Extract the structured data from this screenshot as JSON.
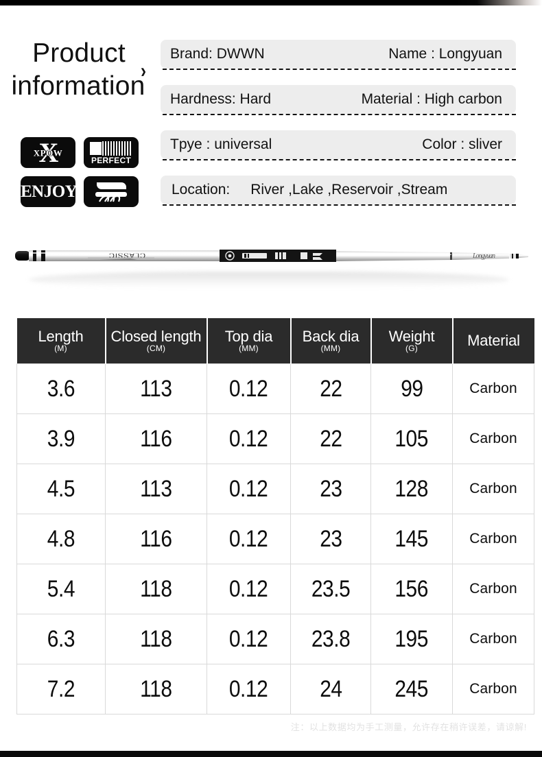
{
  "heading": {
    "line1": "Product",
    "line2": "information",
    "chevron": "›"
  },
  "badges": [
    {
      "name": "xpow-badge",
      "label": "XPOW",
      "mark": "X"
    },
    {
      "name": "perfect-badge",
      "label": "PERFECT"
    },
    {
      "name": "enjoy-badge",
      "label": "ENJOY"
    },
    {
      "name": "grip-badge",
      "label": ""
    }
  ],
  "specs": [
    {
      "left": "Brand: DWWN",
      "right": "Name : Longyuan"
    },
    {
      "left": "Hardness: Hard",
      "right": "Material : High carbon"
    },
    {
      "left": "Tpye : universal",
      "right": "Color : sliver"
    },
    {
      "left": "Location:",
      "right": "River ,Lake ,Reservoir ,Stream",
      "single": true
    }
  ],
  "product_image": {
    "alt": "telescopic silver carbon fishing rod",
    "decal_text": "CLASSIC"
  },
  "table": {
    "columns": [
      {
        "name": "Length",
        "unit": "(M)"
      },
      {
        "name": "Closed length",
        "unit": "(CM)"
      },
      {
        "name": "Top dia",
        "unit": "(MM)"
      },
      {
        "name": "Back dia",
        "unit": "(MM)"
      },
      {
        "name": "Weight",
        "unit": "(G)"
      },
      {
        "name": "Material",
        "unit": ""
      }
    ],
    "rows": [
      {
        "length": "3.6",
        "closed_length": "113",
        "top_dia": "0.12",
        "back_dia": "22",
        "weight": "99",
        "material": "Carbon"
      },
      {
        "length": "3.9",
        "closed_length": "116",
        "top_dia": "0.12",
        "back_dia": "22",
        "weight": "105",
        "material": "Carbon"
      },
      {
        "length": "4.5",
        "closed_length": "113",
        "top_dia": "0.12",
        "back_dia": "23",
        "weight": "128",
        "material": "Carbon"
      },
      {
        "length": "4.8",
        "closed_length": "116",
        "top_dia": "0.12",
        "back_dia": "23",
        "weight": "145",
        "material": "Carbon"
      },
      {
        "length": "5.4",
        "closed_length": "118",
        "top_dia": "0.12",
        "back_dia": "23.5",
        "weight": "156",
        "material": "Carbon"
      },
      {
        "length": "6.3",
        "closed_length": "118",
        "top_dia": "0.12",
        "back_dia": "23.8",
        "weight": "195",
        "material": "Carbon"
      },
      {
        "length": "7.2",
        "closed_length": "118",
        "top_dia": "0.12",
        "back_dia": "24",
        "weight": "245",
        "material": "Carbon"
      }
    ]
  },
  "footnote": "注：以上数据均为手工测量，允许存在稍许误差，请谅解!",
  "colors": {
    "pill_background": "#ededed",
    "table_header": "#2b2b2b",
    "table_gridline": "#d9d9d9",
    "footnote_text": "#e2e2e2"
  }
}
